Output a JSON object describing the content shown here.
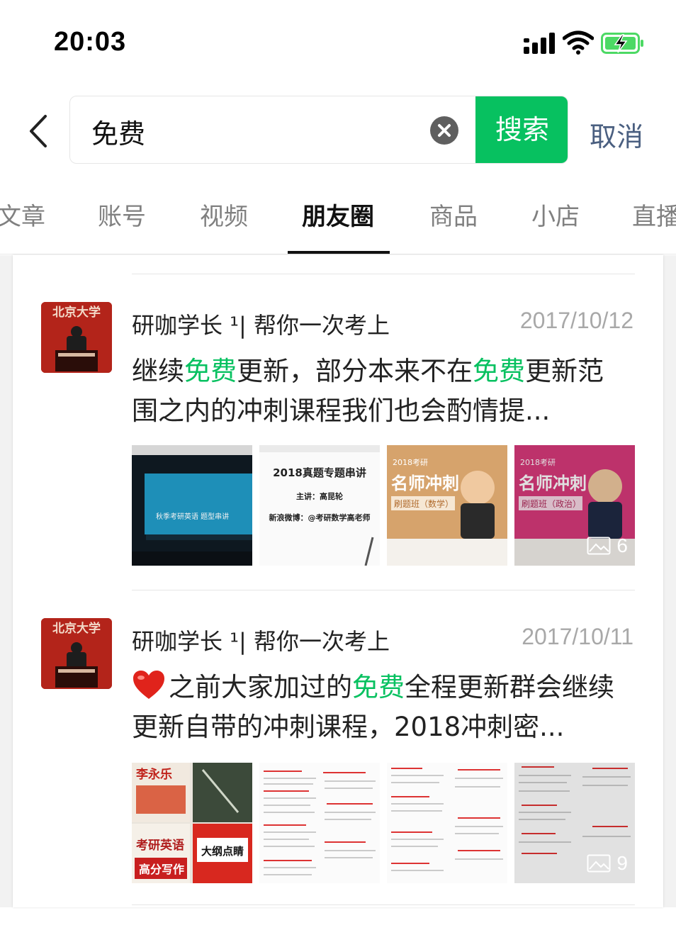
{
  "status_bar": {
    "time": "20:03"
  },
  "search": {
    "query": "免费",
    "search_button": "搜索",
    "cancel": "取消"
  },
  "tabs": [
    {
      "label": "文章"
    },
    {
      "label": "账号"
    },
    {
      "label": "视频"
    },
    {
      "label": "朋友圈"
    },
    {
      "label": "商品"
    },
    {
      "label": "小店"
    },
    {
      "label": "直播"
    }
  ],
  "active_tab": "朋友圈",
  "colors": {
    "accent": "#07c160",
    "cancel_text": "#4a5f80"
  },
  "posts": [
    {
      "avatar_text": "北京大学",
      "author": "研咖学长 ¹| 帮你一次考上",
      "date": "2017/10/12",
      "text_parts": [
        "继续",
        "免费",
        "更新，部分本来不在",
        "免费",
        "更新范围之内的冲刺课程我们也会酌情提..."
      ],
      "images": [
        {
          "caption": "秋季考研英语 题型串讲"
        },
        {
          "title": "2018真题专题串讲",
          "line1": "主讲：高昆轮",
          "line2": "新浪微博：@考研数学高老师"
        },
        {
          "tag": "2018考研",
          "title": "名师冲刺",
          "sub": "刷题班（数学）"
        },
        {
          "tag": "2018考研",
          "title": "名师冲刺",
          "sub": "刷题班（政治）"
        }
      ],
      "image_count": "6"
    },
    {
      "avatar_text": "北京大学",
      "author": "研咖学长 ¹| 帮你一次考上",
      "date": "2017/10/11",
      "text_parts": [
        "之前大家加过的",
        "免费",
        "全程更新群会继续更新自带的冲刺课程，2018冲刺密..."
      ],
      "images": [
        {
          "book1": "李永乐",
          "book2": "考研英语",
          "book3": "高分写作",
          "book4": "大纲点睛"
        },
        {
          "kind": "document"
        },
        {
          "kind": "document"
        },
        {
          "kind": "document"
        }
      ],
      "image_count": "9"
    }
  ]
}
